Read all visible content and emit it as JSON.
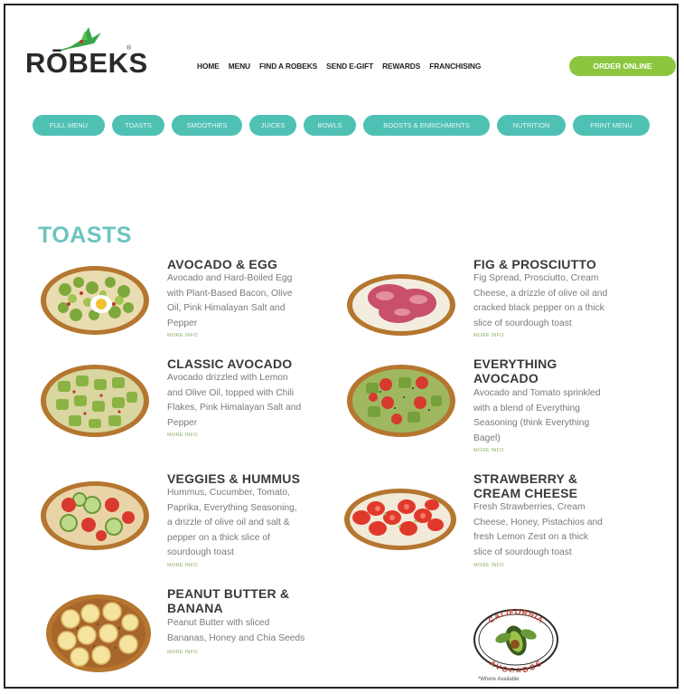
{
  "brand": {
    "name": "RŌBEKS",
    "reg": "®"
  },
  "nav": [
    "HOME",
    "MENU",
    "FIND A ROBEKS",
    "SEND E-GIFT",
    "REWARDS",
    "FRANCHISING"
  ],
  "order_button": "ORDER ONLINE",
  "pills": [
    "FULL MENU",
    "TOASTS",
    "SMOOTHIES",
    "JUICES",
    "BOWLS",
    "BOOSTS & ENRICHMENTS",
    "NUTRITION",
    "PRINT MENU"
  ],
  "section_title": "TOASTS",
  "items": [
    {
      "name": [
        "AVOCADO & EGG"
      ],
      "desc": [
        "Avocado and Hard-Boiled Egg",
        "with Plant-Based Bacon, Olive",
        "Oil, Pink Himalayan Salt and",
        "Pepper"
      ],
      "more": "MORE INFO"
    },
    {
      "name": [
        "FIG & PROSCIUTTO"
      ],
      "desc": [
        "Fig Spread, Prosciutto, Cream",
        "Cheese, a drizzle of olive oil and",
        "cracked black pepper on a thick",
        "slice of sourdough toast"
      ],
      "more": "MORE INFO"
    },
    {
      "name": [
        "CLASSIC AVOCADO"
      ],
      "desc": [
        "Avocado drizzled with Lemon",
        "and Olive Oil, topped with Chili",
        "Flakes, Pink Himalayan Salt and",
        "Pepper"
      ],
      "more": "MORE INFO"
    },
    {
      "name": [
        "EVERYTHING",
        "AVOCADO"
      ],
      "desc": [
        "Avocado and Tomato sprinkled",
        "with a blend of Everything",
        "Seasoning (think Everything",
        "Bagel)"
      ],
      "more": "MORE INFO"
    },
    {
      "name": [
        "VEGGIES & HUMMUS"
      ],
      "desc": [
        "Hummus, Cucumber, Tomato,",
        "Paprika, Everything Seasoning,",
        "a drizzle of olive oil and salt &",
        "pepper on a thick slice of",
        "sourdough toast"
      ],
      "more": "MORE INFO"
    },
    {
      "name": [
        "STRAWBERRY &",
        "CREAM CHEESE"
      ],
      "desc": [
        "Fresh Strawberries, Cream",
        "Cheese, Honey, Pistachios and",
        "fresh Lemon Zest on a thick",
        "slice of sourdough toast"
      ],
      "more": "MORE INFO"
    },
    {
      "name": [
        "PEANUT BUTTER &",
        "BANANA"
      ],
      "desc": [
        "Peanut Butter with sliced",
        "Bananas, Honey and Chia Seeds"
      ],
      "more": "MORE INFO"
    }
  ],
  "badge": {
    "top": "CALIFORNIA",
    "bottom": "AVOCADOS"
  },
  "where_available": "*Where Available",
  "colors": {
    "teal": "#4fc1b4",
    "green": "#8cc63f",
    "title": "#6cc5bf"
  }
}
